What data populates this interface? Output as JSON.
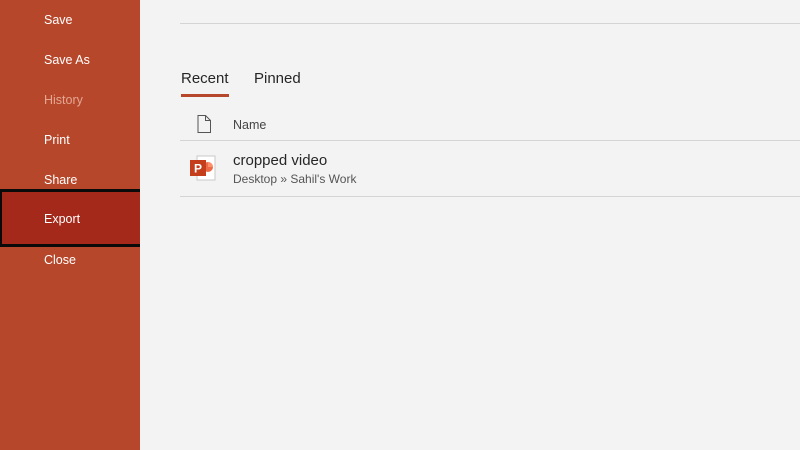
{
  "sidebar": {
    "items": [
      {
        "label": "Save",
        "state": "normal"
      },
      {
        "label": "Save As",
        "state": "normal"
      },
      {
        "label": "History",
        "state": "disabled"
      },
      {
        "label": "Print",
        "state": "normal"
      },
      {
        "label": "Share",
        "state": "normal"
      },
      {
        "label": "Export",
        "state": "selected"
      },
      {
        "label": "Close",
        "state": "normal"
      }
    ]
  },
  "main": {
    "tabs": [
      {
        "label": "Recent",
        "active": true
      },
      {
        "label": "Pinned",
        "active": false
      }
    ],
    "list": {
      "header_name": "Name",
      "files": [
        {
          "name": "cropped video",
          "path": "Desktop » Sahil's Work",
          "icon": "powerpoint-file-icon"
        }
      ]
    }
  },
  "colors": {
    "sidebar_bg": "#b7472a",
    "sidebar_selected": "#a4291a",
    "accent": "#b7472a",
    "main_bg": "#f3f3f3"
  }
}
